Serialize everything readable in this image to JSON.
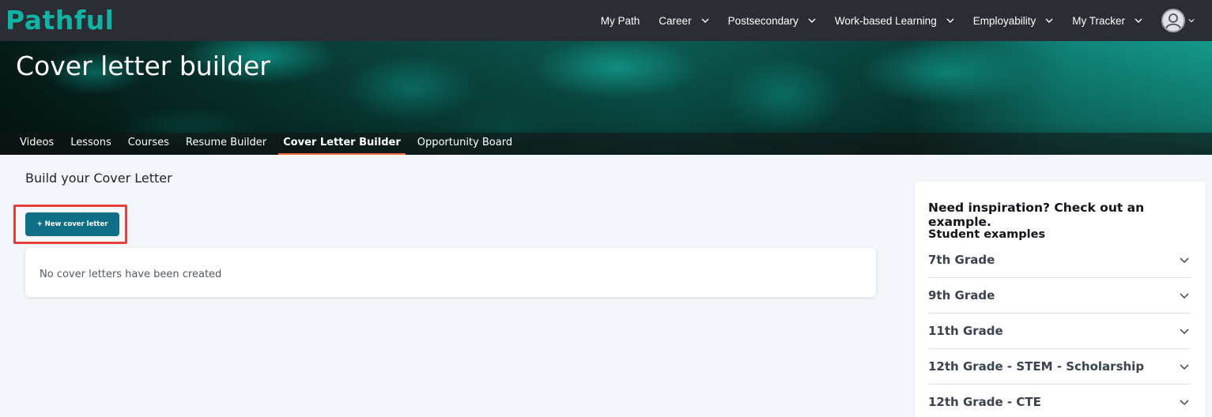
{
  "brand": {
    "logo_text": "Pathful",
    "color": "#12b3a5"
  },
  "topnav": {
    "items": [
      {
        "label": "My Path",
        "has_dropdown": false
      },
      {
        "label": "Career",
        "has_dropdown": true
      },
      {
        "label": "Postsecondary",
        "has_dropdown": true
      },
      {
        "label": "Work-based Learning",
        "has_dropdown": true
      },
      {
        "label": "Employability",
        "has_dropdown": true
      },
      {
        "label": "My Tracker",
        "has_dropdown": true
      }
    ],
    "avatar_icon": "user-avatar-icon"
  },
  "hero": {
    "title": "Cover letter builder",
    "tabs": [
      {
        "label": "Videos",
        "active": false
      },
      {
        "label": "Lessons",
        "active": false
      },
      {
        "label": "Courses",
        "active": false
      },
      {
        "label": "Resume Builder",
        "active": false
      },
      {
        "label": "Cover Letter Builder",
        "active": true
      },
      {
        "label": "Opportunity Board",
        "active": false
      }
    ],
    "active_tab_color": "#f26a3b"
  },
  "main": {
    "heading": "Build your Cover Letter",
    "new_button_label": "+ New cover letter",
    "button_color": "#0f6f86",
    "highlight_color": "#e5413a",
    "empty_message": "No cover letters have been created"
  },
  "sidebar": {
    "title": "Need inspiration? Check out an example.",
    "subtitle": "Student examples",
    "items": [
      {
        "label": "7th Grade"
      },
      {
        "label": "9th Grade"
      },
      {
        "label": "11th Grade"
      },
      {
        "label": "12th Grade - STEM - Scholarship"
      },
      {
        "label": "12th Grade - CTE"
      }
    ]
  }
}
